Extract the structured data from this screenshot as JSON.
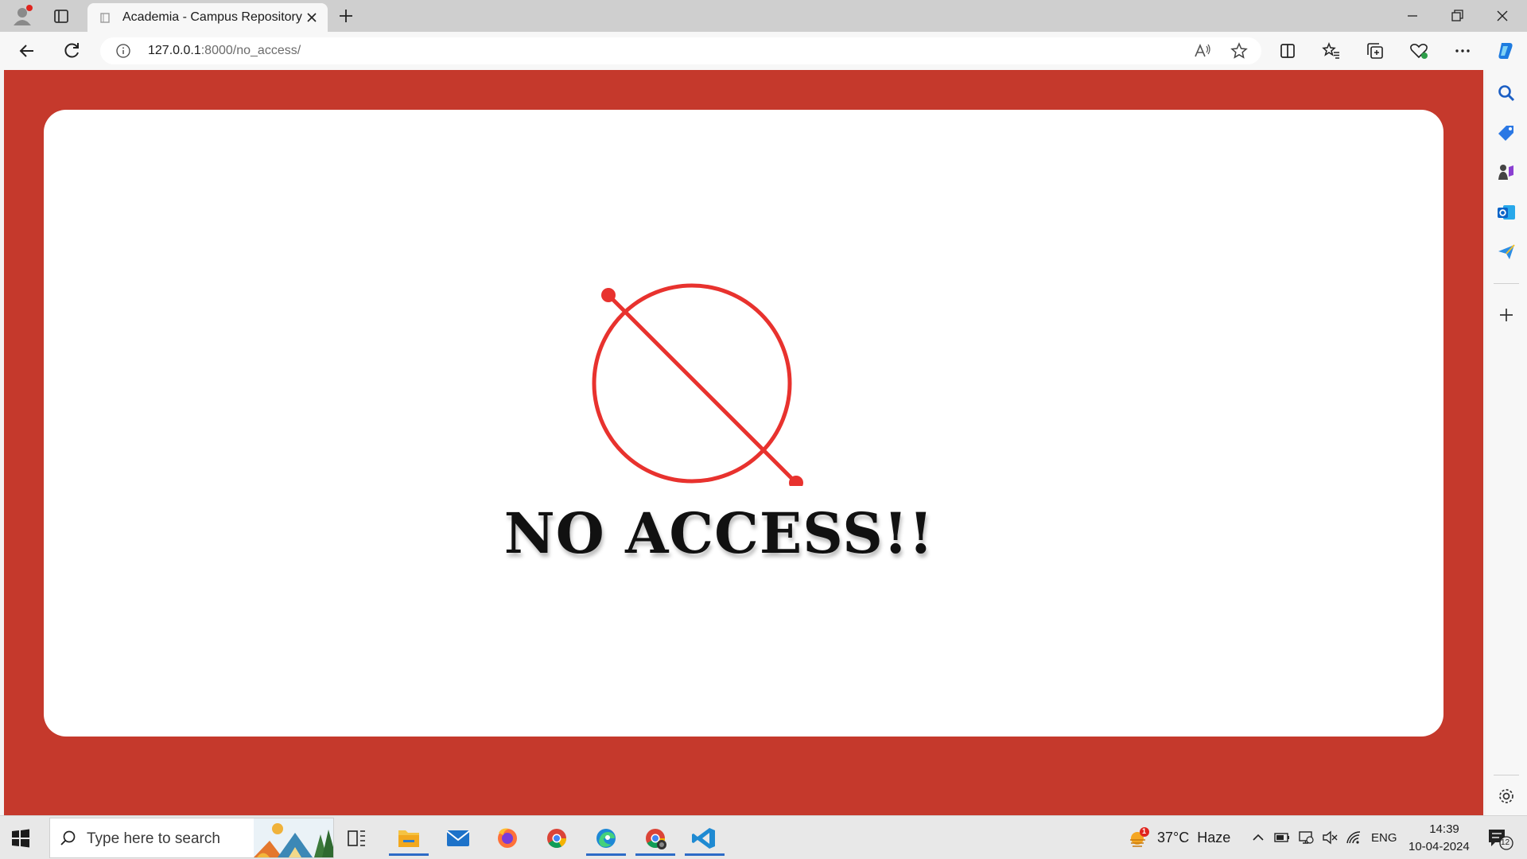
{
  "browser": {
    "tab": {
      "title": "Academia - Campus Repository"
    },
    "address": {
      "host": "127.0.0.1",
      "rest": ":8000/no_access/"
    }
  },
  "page": {
    "heading": "NO ACCESS!!",
    "colors": {
      "background": "#c5392c",
      "card": "#ffffff",
      "icon": "#e8322e",
      "heading": "#111111"
    },
    "icon": "no-access-icon"
  },
  "taskbar": {
    "search_placeholder": "Type here to search",
    "weather": "37°C  Haze",
    "weather_badge": "1",
    "language": "ENG",
    "time": "14:39",
    "date": "10-04-2024",
    "notification_count": "12"
  }
}
